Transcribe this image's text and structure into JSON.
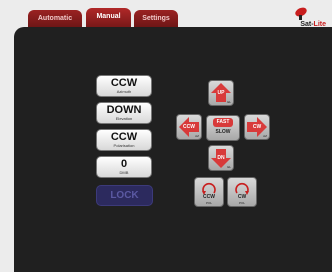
{
  "tabs": [
    {
      "label": "Automatic"
    },
    {
      "label": "Manual"
    },
    {
      "label": "Settings"
    }
  ],
  "logo": {
    "part1": "Sat-",
    "part2": "Lite"
  },
  "status": [
    {
      "value": "CCW",
      "caption": "Azimuth"
    },
    {
      "value": "DOWN",
      "caption": "Elevation"
    },
    {
      "value": "CCW",
      "caption": "Polarisation"
    },
    {
      "value": "0",
      "caption": "DMB"
    }
  ],
  "lock_label": "LOCK",
  "dpad": {
    "up": {
      "label": "UP",
      "sub": "EL"
    },
    "left": {
      "label": "CCW",
      "sub": "AZ"
    },
    "right": {
      "label": "CW",
      "sub": "AZ"
    },
    "down": {
      "label": "DN",
      "sub": "EL"
    },
    "fast": "FAST",
    "slow": "SLOW"
  },
  "pol": {
    "ccw": {
      "label": "CCW",
      "sub": "POL"
    },
    "cw": {
      "label": "CW",
      "sub": "POL"
    }
  },
  "colors": {
    "accent": "#c81e1e",
    "panel": "#202020",
    "lock": "#2c2a5e"
  }
}
